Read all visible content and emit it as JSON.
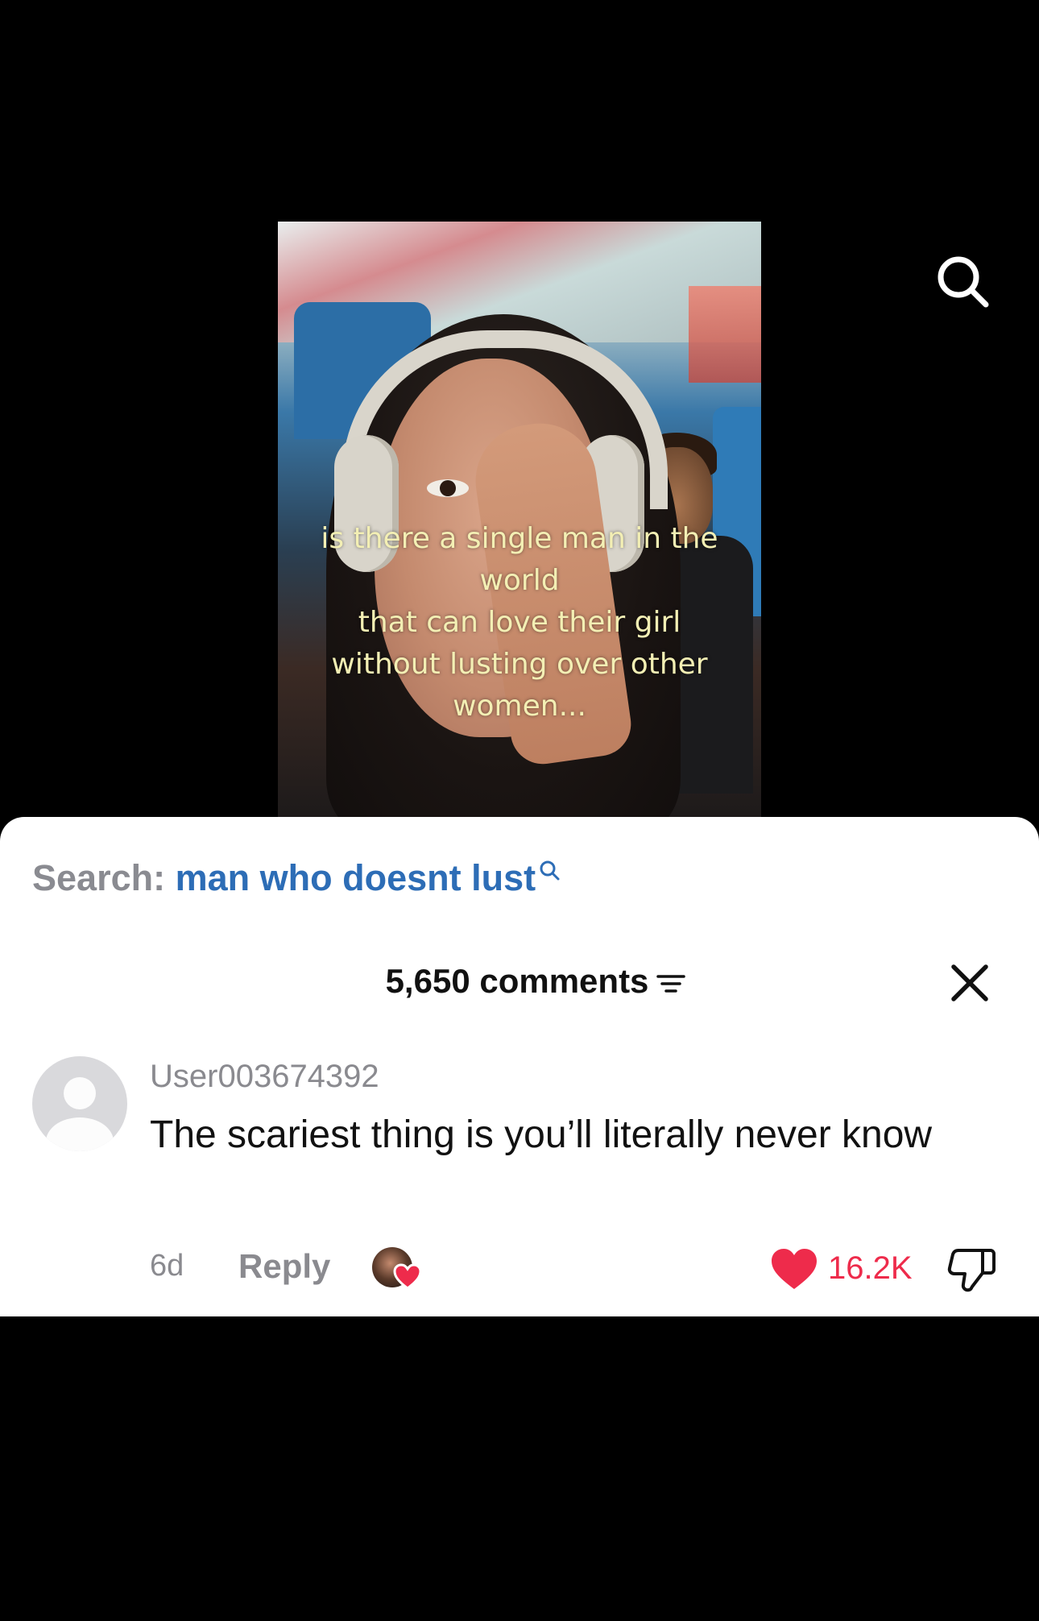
{
  "video": {
    "caption": "is there a single man in the\nworld\nthat can love their girl\nwithout lusting over other\nwomen..."
  },
  "top_icons": {
    "search_icon": "search-icon"
  },
  "comment_sheet": {
    "search_label": "Search:",
    "search_query": "man who doesnt lust",
    "comments_count_label": "5,650 comments",
    "close_icon": "close-icon",
    "filter_icon": "filter-icon"
  },
  "comment": {
    "username": "User003674392",
    "text": "The scariest thing is you’ll literally never know",
    "age": "6d",
    "reply_label": "Reply",
    "like_count": "16.2K"
  },
  "colors": {
    "like_red": "#ee2b4b",
    "search_blue": "#2d6db6",
    "caption_yellow": "#f3efb4"
  }
}
